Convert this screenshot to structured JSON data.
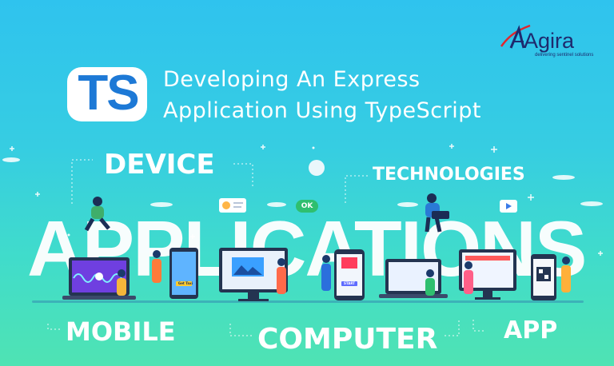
{
  "brand": {
    "name": "Agira",
    "tagline": "delivering sentinel solutions"
  },
  "badge": {
    "text": "TS"
  },
  "title": {
    "line1": "Developing An Express",
    "line2": "Application Using TypeScript"
  },
  "labels": {
    "device": "DEVICE",
    "technologies": "TECHNOLOGIES",
    "mobile": "MOBILE",
    "computer": "COMPUTER",
    "app": "APP"
  },
  "hero_word": "APPLICATIONS",
  "bubbles": {
    "ok": "OK"
  },
  "screens": {
    "tablet_button": "Get Taxi",
    "phone_button": "START"
  },
  "colors": {
    "background_top": "#2fc3ee",
    "background_bottom": "#4fe3b3",
    "badge_blue": "#1d79d6",
    "brand_navy": "#1e2a6e",
    "brand_red": "#e1262d",
    "device_dark": "#243451"
  }
}
